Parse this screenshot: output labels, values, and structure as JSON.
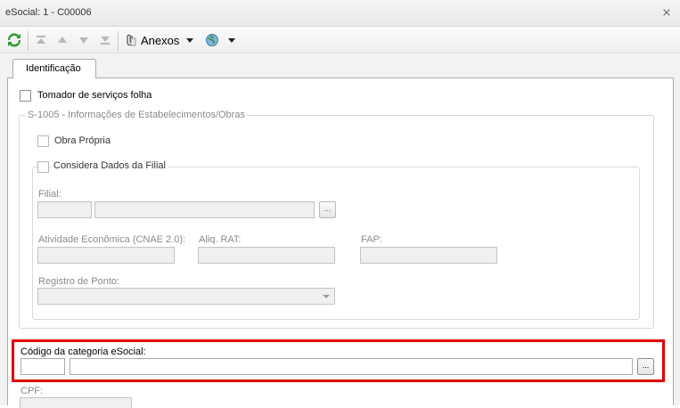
{
  "window": {
    "title": "eSocial: 1 - C00006",
    "close_icon": "close-icon"
  },
  "toolbar": {
    "refresh_icon": "refresh-icon",
    "first_icon": "first-record-icon",
    "prev_icon": "previous-record-icon",
    "next_icon": "next-record-icon",
    "last_icon": "last-record-icon",
    "attachments_icon": "paperclip-icon",
    "anexos_label": "Anexos",
    "globe_icon": "globe-icon"
  },
  "tabs": [
    {
      "label": "Identificação",
      "active": true
    }
  ],
  "form": {
    "tomador_label": "Tomador de serviços folha",
    "tomador_checked": false,
    "group_s1005": {
      "legend": "S-1005 - Informações de Estabelecimentos/Obras",
      "obra_propria_label": "Obra Própria",
      "considera_label": "Considera Dados da Filial",
      "filial_label": "Filial:",
      "filial_code": "",
      "filial_name": "",
      "lookup_button": "...",
      "cnae_label": "Atividade Econômica (CNAE 2.0):",
      "cnae_value": "",
      "aliq_rat_label": "Aliq. RAT:",
      "aliq_rat_value": "",
      "fap_label": "FAP:",
      "fap_value": "",
      "registro_ponto_label": "Registro de Ponto:",
      "registro_ponto_value": ""
    },
    "categoria": {
      "label": "Código da categoria eSocial:",
      "code": "",
      "description": "",
      "lookup_button": "..."
    },
    "cpf": {
      "label": "CPF:",
      "value": ""
    }
  },
  "colors": {
    "highlight": "#e00000",
    "accent_green": "#2e9a2e"
  }
}
